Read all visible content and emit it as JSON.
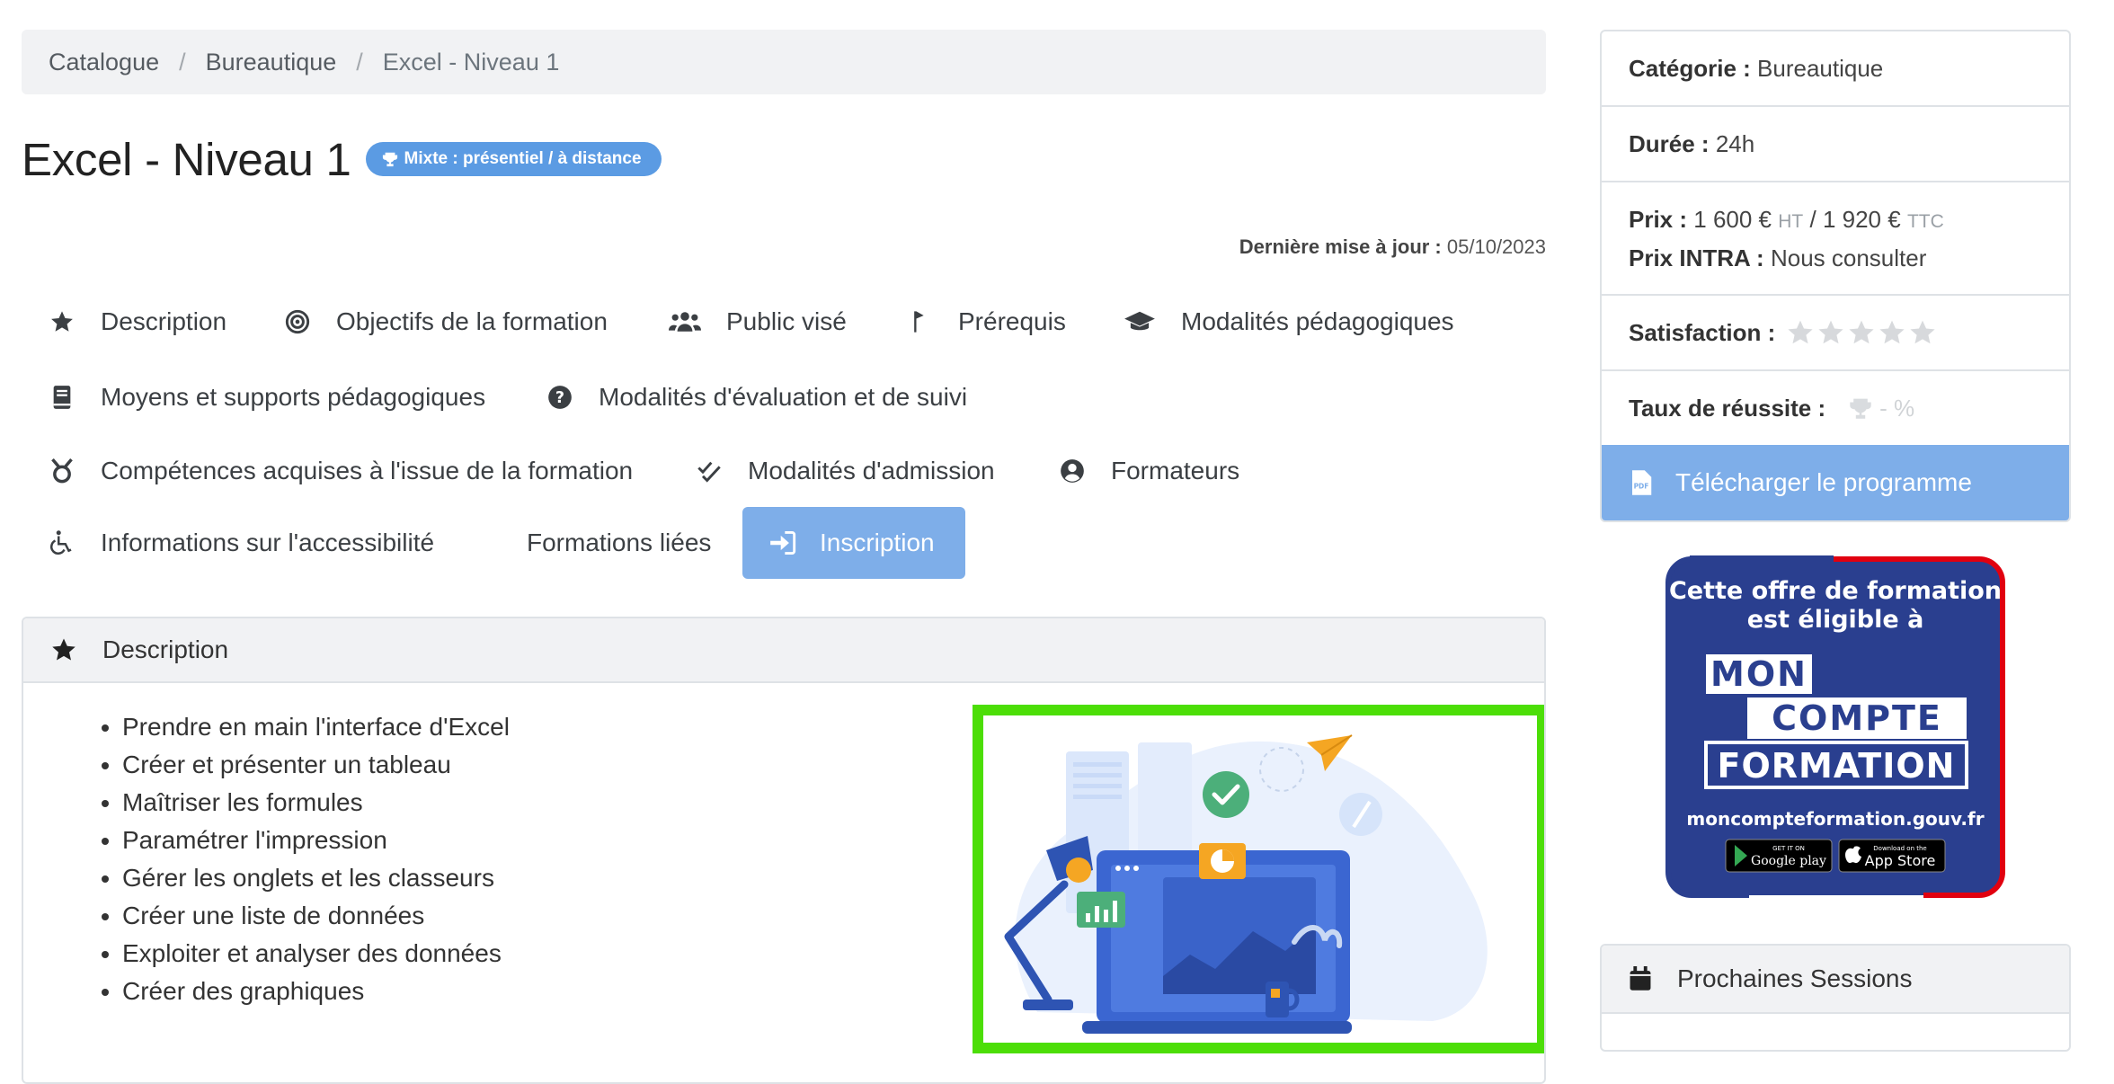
{
  "breadcrumb": {
    "items": [
      "Catalogue",
      "Bureautique",
      "Excel - Niveau 1"
    ],
    "separator": "/"
  },
  "page": {
    "title": "Excel - Niveau 1",
    "mode_badge": "Mixte : présentiel / à distance",
    "updated_label": "Dernière mise à jour :",
    "updated_value": "05/10/2023"
  },
  "tabs": [
    {
      "label": "Description",
      "icon": "star-icon"
    },
    {
      "label": "Objectifs de la formation",
      "icon": "target-icon"
    },
    {
      "label": "Public visé",
      "icon": "users-icon"
    },
    {
      "label": "Prérequis",
      "icon": "flag-icon"
    },
    {
      "label": "Modalités pédagogiques",
      "icon": "graduation-cap-icon"
    },
    {
      "label": "Moyens et supports pédagogiques",
      "icon": "book-icon"
    },
    {
      "label": "Modalités d'évaluation et de suivi",
      "icon": "question-circle-icon"
    },
    {
      "label": "Compétences acquises à l'issue de la formation",
      "icon": "medal-icon"
    },
    {
      "label": "Modalités d'admission",
      "icon": "double-check-icon"
    },
    {
      "label": "Formateurs",
      "icon": "user-circle-icon"
    },
    {
      "label": "Informations sur l'accessibilité",
      "icon": "wheelchair-icon"
    },
    {
      "label": "Formations liées",
      "icon": ""
    },
    {
      "label": "Inscription",
      "icon": "sign-in-icon",
      "active": true
    }
  ],
  "description": {
    "heading": "Description",
    "items": [
      "Prendre en main l'interface d'Excel",
      "Créer et présenter un tableau",
      "Maîtriser les formules",
      "Paramétrer l'impression",
      "Gérer les onglets et les classeurs",
      "Créer une liste de données",
      "Exploiter et analyser des données",
      "Créer des graphiques"
    ]
  },
  "sidebar": {
    "category_label": "Catégorie :",
    "category_value": "Bureautique",
    "duration_label": "Durée :",
    "duration_value": "24h",
    "price_label": "Prix :",
    "price_ht": "1 600 €",
    "ht": "HT",
    "price_slash": "/",
    "price_ttc": "1 920 €",
    "ttc": "TTC",
    "intra_label": "Prix INTRA :",
    "intra_value": "Nous consulter",
    "satisfaction_label": "Satisfaction :",
    "satisfaction_stars": 0,
    "satisfaction_max": 5,
    "success_label": "Taux de réussite :",
    "success_value": "- %",
    "download_label": "Télécharger le programme"
  },
  "cpf": {
    "line1": "Cette offre de formation",
    "line2": "est éligible à",
    "mon": "MON",
    "compte": "COMPTE",
    "formation": "FORMATION",
    "site": "moncompteformation.gouv.fr",
    "google_small": "GET IT ON",
    "google_play": "Google play",
    "apple_small": "Download on the",
    "app_store": "App Store"
  },
  "sessions": {
    "heading": "Prochaines Sessions"
  },
  "colors": {
    "accent": "#7eaee9",
    "badge": "#5b9be3",
    "highlight_border": "#4cde07",
    "cpf_blue": "#2a3f8f",
    "cpf_red": "#e1000f"
  }
}
